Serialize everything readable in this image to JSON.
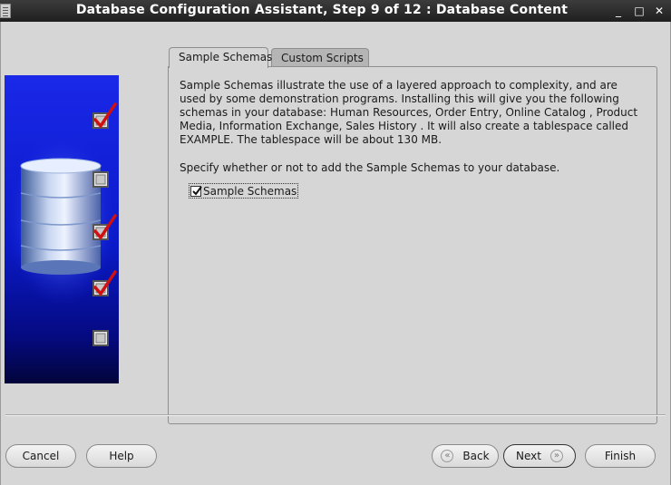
{
  "window": {
    "title": "Database Configuration Assistant, Step 9 of 12 : Database Content",
    "controls": {
      "minimize": "_",
      "maximize": "□",
      "close": "✕"
    }
  },
  "tabs": [
    {
      "label": "Sample Schemas",
      "active": true
    },
    {
      "label": "Custom Scripts",
      "active": false
    }
  ],
  "content": {
    "description": "Sample Schemas illustrate the use of a layered approach to complexity, and are used by some demonstration programs. Installing this will give you the following schemas in your database: Human Resources, Order Entry, Online Catalog , Product Media, Information Exchange, Sales History . It will also create a tablespace called EXAMPLE. The tablespace will be about 130 MB.",
    "prompt": "Specify whether or not to add the Sample Schemas to your database.",
    "checkbox": {
      "label": "Sample Schemas",
      "checked": true
    }
  },
  "side_panel": {
    "steps_checked": [
      true,
      false,
      true,
      true,
      false
    ]
  },
  "buttons": {
    "cancel": "Cancel",
    "help": "Help",
    "back": "Back",
    "next": "Next",
    "finish": "Finish"
  },
  "colors": {
    "title_bar": "#262626",
    "panel_blue": "#0a1ac8",
    "check_red": "#d01010"
  }
}
